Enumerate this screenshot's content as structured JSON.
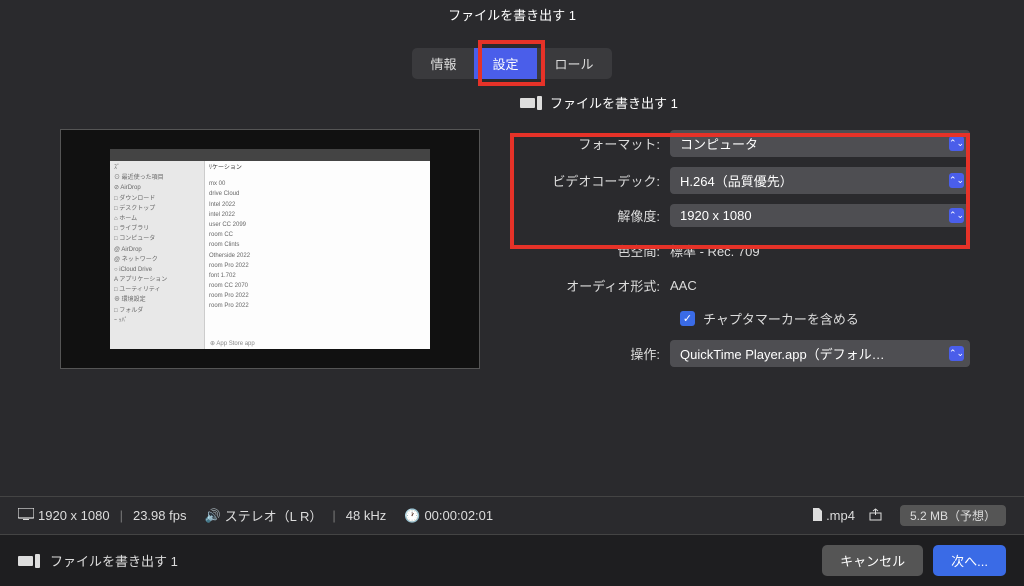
{
  "window": {
    "title": "ファイルを書き出す 1"
  },
  "tabs": {
    "info": "情報",
    "settings": "設定",
    "roles": "ロール"
  },
  "section": {
    "title": "ファイルを書き出す 1"
  },
  "form": {
    "format_label": "フォーマット:",
    "format_value": "コンピュータ",
    "codec_label": "ビデオコーデック:",
    "codec_value": "H.264（品質優先）",
    "resolution_label": "解像度:",
    "resolution_value": "1920 x 1080",
    "colorspace_label": "色空間:",
    "colorspace_value": "標準 - Rec. 709",
    "audio_label": "オーディオ形式:",
    "audio_value": "AAC",
    "chapters_label": "チャプタマーカーを含める",
    "action_label": "操作:",
    "action_value": "QuickTime Player.app（デフォル…"
  },
  "status": {
    "resolution": "1920 x 1080",
    "fps": "23.98 fps",
    "audio": "ステレオ（L R）",
    "rate": "48 kHz",
    "duration": "00:00:02:01",
    "extension": ".mp4",
    "size": "5.2 MB（予想）"
  },
  "footer": {
    "title": "ファイルを書き出す 1",
    "cancel": "キャンセル",
    "next": "次へ..."
  }
}
